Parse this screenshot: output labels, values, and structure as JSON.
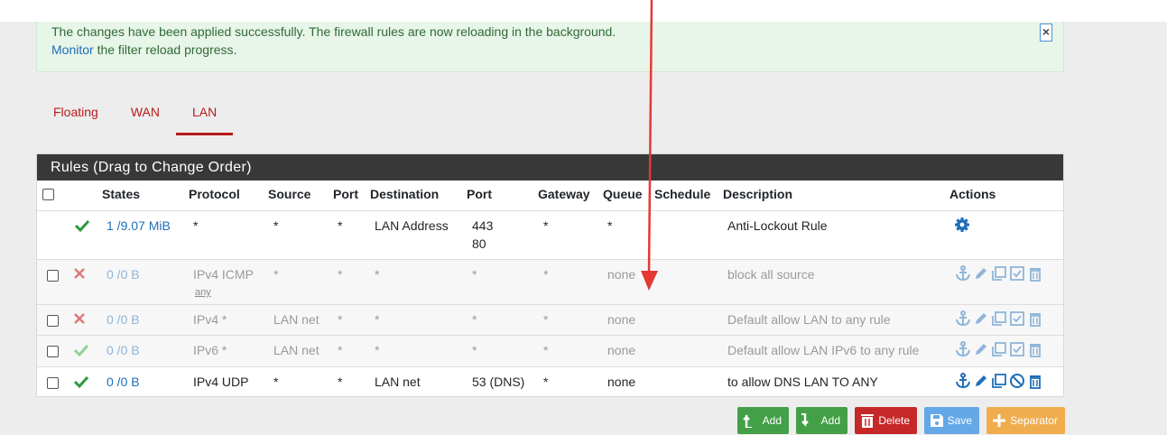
{
  "alert": {
    "message": "The changes have been applied successfully. The firewall rules are now reloading in the background.",
    "link_text": "Monitor",
    "after_link": " the filter reload progress."
  },
  "tabs": [
    {
      "label": "Floating",
      "active": false
    },
    {
      "label": "WAN",
      "active": false
    },
    {
      "label": "LAN",
      "active": true
    }
  ],
  "panel_title": "Rules (Drag to Change Order)",
  "columns": [
    "States",
    "Protocol",
    "Source",
    "Port",
    "Destination",
    "Port",
    "Gateway",
    "Queue",
    "Schedule",
    "Description",
    "Actions"
  ],
  "rules": [
    {
      "status": "pass",
      "enabled": true,
      "states": "1 /9.07 MiB",
      "protocol": "*",
      "protocol_sub": "",
      "source": "*",
      "src_port": "*",
      "destination": "LAN Address",
      "dst_port": "443",
      "dst_port2": "80",
      "gateway": "*",
      "queue": "*",
      "schedule": "",
      "description": "Anti-Lockout Rule"
    },
    {
      "status": "block",
      "enabled": false,
      "states": "0 /0 B",
      "protocol": "IPv4 ICMP",
      "protocol_sub": "any",
      "source": "*",
      "src_port": "*",
      "destination": "*",
      "dst_port": "*",
      "dst_port2": "",
      "gateway": "*",
      "queue": "none",
      "schedule": "",
      "description": "block all source"
    },
    {
      "status": "block",
      "enabled": false,
      "states": "0 /0 B",
      "protocol": "IPv4 *",
      "protocol_sub": "",
      "source": "LAN net",
      "src_port": "*",
      "destination": "*",
      "dst_port": "*",
      "dst_port2": "",
      "gateway": "*",
      "queue": "none",
      "schedule": "",
      "description": "Default allow LAN to any rule"
    },
    {
      "status": "pass",
      "enabled": false,
      "states": "0 /0 B",
      "protocol": "IPv6 *",
      "protocol_sub": "",
      "source": "LAN net",
      "src_port": "*",
      "destination": "*",
      "dst_port": "*",
      "dst_port2": "",
      "gateway": "*",
      "queue": "none",
      "schedule": "",
      "description": "Default allow LAN IPv6 to any rule"
    },
    {
      "status": "pass",
      "enabled": true,
      "states": "0 /0 B",
      "protocol": "IPv4 UDP",
      "protocol_sub": "",
      "source": "*",
      "src_port": "*",
      "destination": "LAN net",
      "dst_port": "53 (DNS)",
      "dst_port2": "",
      "gateway": "*",
      "queue": "none",
      "schedule": "",
      "description": "to allow DNS LAN TO ANY"
    }
  ],
  "buttons": {
    "add_top": "Add",
    "add_bottom": "Add",
    "delete": "Delete",
    "save": "Save",
    "separator": "Separator"
  },
  "colors": {
    "pass": "#2e9a3e",
    "block": "#c62828",
    "btn_add": "#43a047",
    "btn_delete": "#c62828",
    "btn_save": "#64a8e8",
    "btn_separator": "#f0ad4e",
    "accent_link": "#1e6fb8",
    "annotation_arrow": "#e53935"
  },
  "icons": [
    "close-icon",
    "check-icon",
    "cross-icon",
    "gear-icon",
    "anchor-icon",
    "pencil-icon",
    "copy-icon",
    "check-square-icon",
    "ban-icon",
    "trash-icon",
    "arrow-up-icon",
    "arrow-down-icon",
    "save-icon",
    "plus-icon"
  ]
}
